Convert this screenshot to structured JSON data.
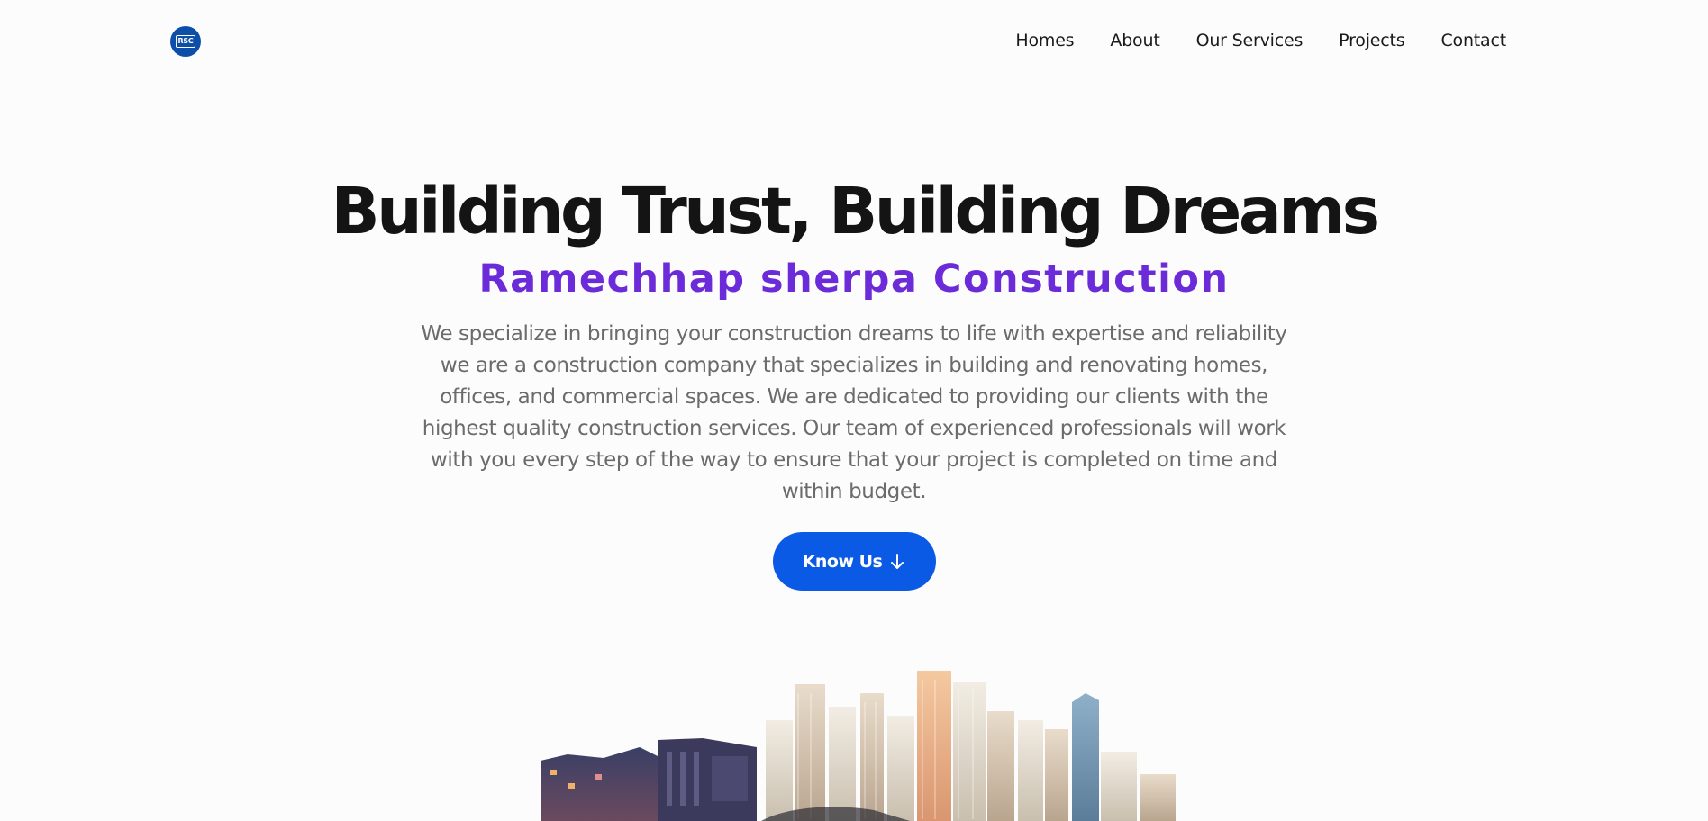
{
  "header": {
    "logo_text": "RSC",
    "nav": [
      {
        "label": "Homes"
      },
      {
        "label": "About"
      },
      {
        "label": "Our Services"
      },
      {
        "label": "Projects"
      },
      {
        "label": "Contact"
      }
    ]
  },
  "hero": {
    "title": "Building Trust, Building Dreams",
    "subtitle": "Ramechhap sherpa Construction",
    "description": "We specialize in bringing your construction dreams to life with expertise and reliability we are a construction company that specializes in building and renovating homes, offices, and commercial spaces. We are dedicated to providing our clients with the highest quality construction services. Our team of experienced professionals will work with you every step of the way to ensure that your project is completed on time and within budget.",
    "cta_label": "Know Us",
    "cta_icon": "arrow-down-icon"
  },
  "illustration": {
    "icon": "city-skyline-image"
  },
  "colors": {
    "accent": "#6b2bd9",
    "button": "#0a5ae6",
    "logo": "#0d4fa8"
  }
}
